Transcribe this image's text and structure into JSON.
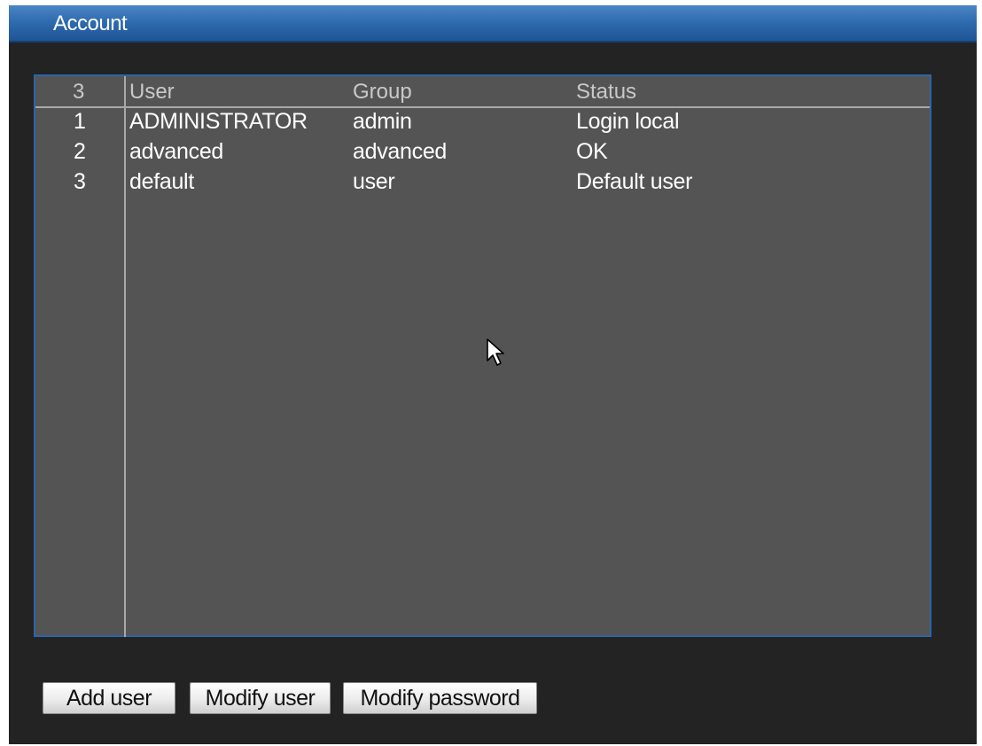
{
  "window": {
    "title": "Account"
  },
  "table": {
    "count": "3",
    "headers": {
      "user": "User",
      "group": "Group",
      "status": "Status"
    },
    "rows": [
      {
        "index": "1",
        "user": "ADMINISTRATOR",
        "group": "admin",
        "status": "Login local"
      },
      {
        "index": "2",
        "user": "advanced",
        "group": "advanced",
        "status": "OK"
      },
      {
        "index": "3",
        "user": "default",
        "group": "user",
        "status": "Default user"
      }
    ]
  },
  "buttons": {
    "add_user": "Add user",
    "modify_user": "Modify user",
    "modify_password": "Modify password"
  },
  "colors": {
    "title_bar": "#2f6cb0",
    "background": "#232323",
    "list_background": "#545454",
    "list_border": "#2d64a8"
  },
  "icons": {
    "pointer": "mouse-pointer-icon"
  }
}
